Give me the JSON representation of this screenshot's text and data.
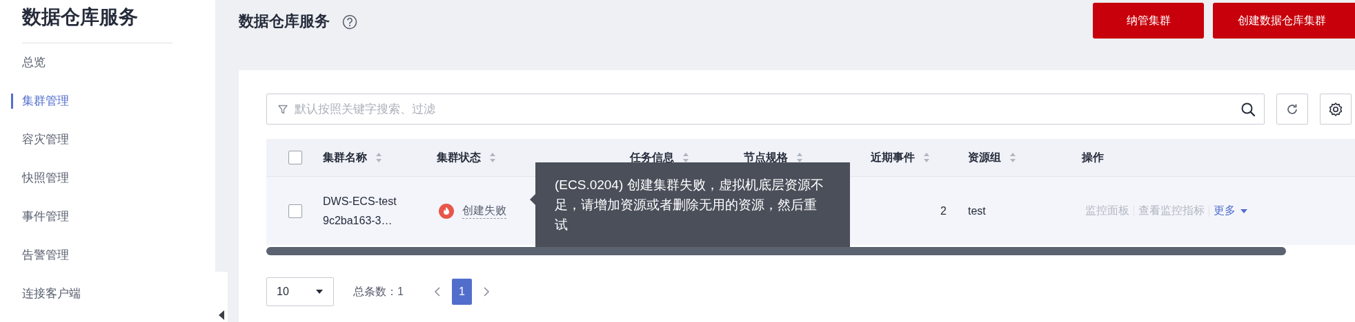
{
  "sidebar": {
    "title": "数据仓库服务",
    "items": [
      {
        "label": "总览",
        "selected": false
      },
      {
        "label": "集群管理",
        "selected": true
      },
      {
        "label": "容灾管理",
        "selected": false
      },
      {
        "label": "快照管理",
        "selected": false
      },
      {
        "label": "事件管理",
        "selected": false
      },
      {
        "label": "告警管理",
        "selected": false
      },
      {
        "label": "连接客户端",
        "selected": false
      }
    ]
  },
  "header": {
    "title": "数据仓库服务",
    "buttons": [
      "纳管集群",
      "创建数据仓库集群"
    ]
  },
  "search": {
    "placeholder": "默认按照关键字搜索、过滤"
  },
  "table": {
    "select_all": {
      "checked": false
    },
    "columns": [
      {
        "label": "集群名称",
        "sortable": true
      },
      {
        "label": "集群状态",
        "sortable": true
      },
      {
        "label": "任务信息",
        "sortable": true
      },
      {
        "label": "节点规格",
        "sortable": true
      },
      {
        "label": "近期事件",
        "sortable": true
      },
      {
        "label": "资源组",
        "sortable": true
      },
      {
        "label": "操作",
        "sortable": false
      }
    ],
    "rows": [
      {
        "checked": false,
        "name": "DWS-ECS-test",
        "id": "9c2ba163-3…",
        "status": "创建失败",
        "events": "2",
        "resource_group": "test",
        "actions": [
          {
            "label": "监控面板",
            "kind": "link",
            "disabled": true
          },
          {
            "label": "查看监控指标",
            "kind": "link",
            "disabled": true
          },
          {
            "label": "更多",
            "kind": "menu",
            "disabled": false
          }
        ]
      }
    ]
  },
  "tooltip": {
    "text": "(ECS.0204) 创建集群失败，虚拟机底层资源不足，请增加资源或者删除无用的资源，然后重试"
  },
  "pagination": {
    "page_size": "10",
    "total": "总条数：1",
    "pages": [
      {
        "label": "1",
        "selected": true
      }
    ]
  }
}
